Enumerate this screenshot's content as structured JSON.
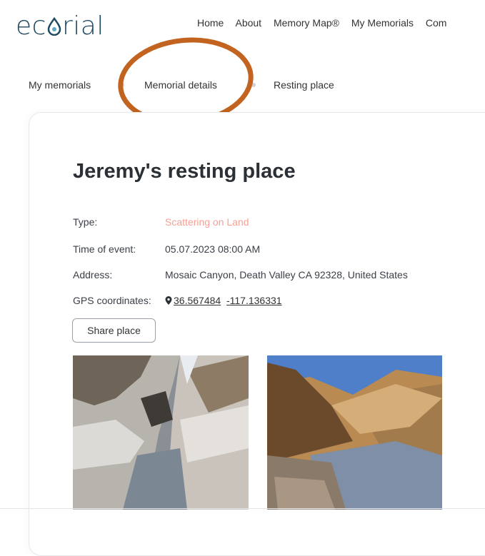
{
  "brand": {
    "logo_text_pre": "ec",
    "logo_text_post": "rial"
  },
  "nav": {
    "items": [
      "Home",
      "About",
      "Memory Map®",
      "My Memorials",
      "Com"
    ]
  },
  "breadcrumb": {
    "items": [
      "My memorials",
      "Memorial details",
      "Resting place"
    ]
  },
  "memorial": {
    "title": "Jeremy's resting place",
    "type_label": "Type:",
    "type_value": "Scattering on Land",
    "time_label": "Time of event:",
    "time_value": "05.07.2023 08:00 AM",
    "address_label": "Address:",
    "address_value": "Mosaic Canyon, Death Valley CA 92328, United States",
    "gps_label": "GPS coordinates:",
    "gps_lat": "36.567484",
    "gps_lng": "-117.136331",
    "share_label": "Share place"
  },
  "icons": {
    "gps": "map-pin-icon"
  },
  "colors": {
    "accent_highlight": "#c2631f",
    "type_value": "#f4a196",
    "logo": "#1f4a63"
  }
}
